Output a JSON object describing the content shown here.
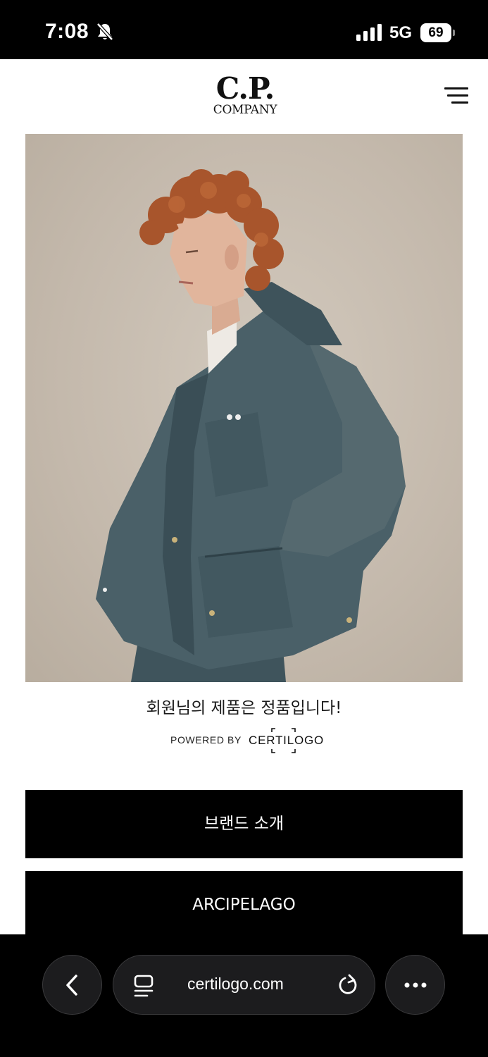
{
  "status_bar": {
    "time": "7:08",
    "network": "5G",
    "battery": "69",
    "icons": [
      "bell-slash-icon",
      "signal-bars-icon",
      "battery-icon"
    ]
  },
  "header": {
    "logo_top": "C.P.",
    "logo_bottom": "COMPANY",
    "menu_icon": "hamburger-menu-icon"
  },
  "hero": {
    "description_icon": "hero-photo"
  },
  "verification": {
    "message": "회원님의 제품은 정품입니다!",
    "powered_by": "POWERED BY",
    "certilogo": "CERTILOGO"
  },
  "buttons": {
    "brand_intro": "브랜드 소개",
    "arcipelago": "ARCIPELAGO"
  },
  "browser": {
    "url": "certilogo.com",
    "icons": [
      "chevron-left-icon",
      "tabs-icon",
      "reload-icon",
      "more-icon"
    ]
  },
  "colors": {
    "background": "#ffffff",
    "button": "#000000",
    "jacket": "#4a6068"
  }
}
